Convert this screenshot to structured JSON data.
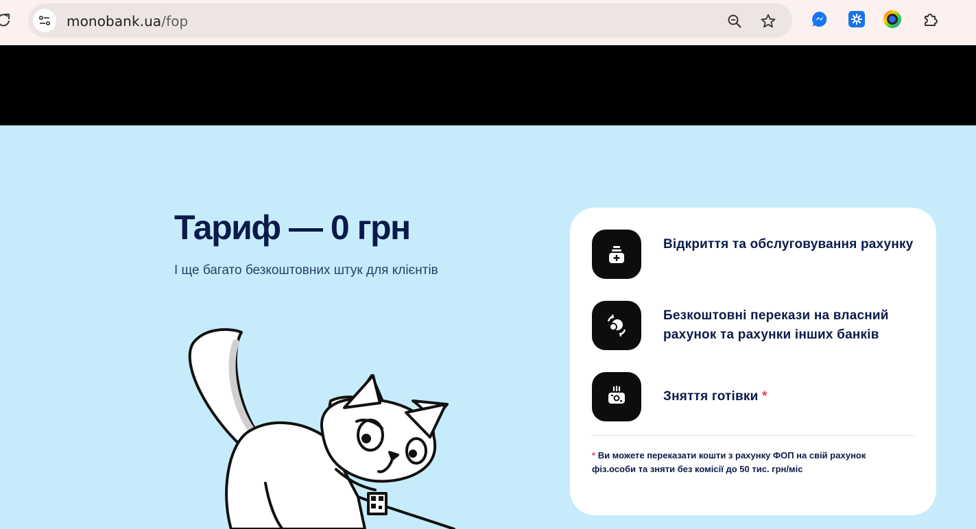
{
  "browser": {
    "url_host": "monobank.ua",
    "url_path": "/fop"
  },
  "hero": {
    "title": "Тариф — 0 грн",
    "subtitle": "І ще багато безкоштовних штук для клієнтів"
  },
  "card": {
    "features": [
      {
        "label": "Відкриття та обслуговування рахунку",
        "icon": "wallet-plus-icon"
      },
      {
        "label": "Безкоштовні перекази на власний рахунок та рахунки інших банків",
        "icon": "coins-transfer-icon"
      },
      {
        "label": "Зняття готівки",
        "asterisk": "*",
        "icon": "cash-withdraw-icon"
      }
    ],
    "note_asterisk": "*",
    "note": "Ви можете переказати кошти з рахунку ФОП на свій рахунок фіз.особи та зняти без комісії до 50 тис. грн/міс"
  },
  "colors": {
    "background": "#c6ecfb",
    "title": "#0b1a4a",
    "accent": "#ee3a4b"
  }
}
